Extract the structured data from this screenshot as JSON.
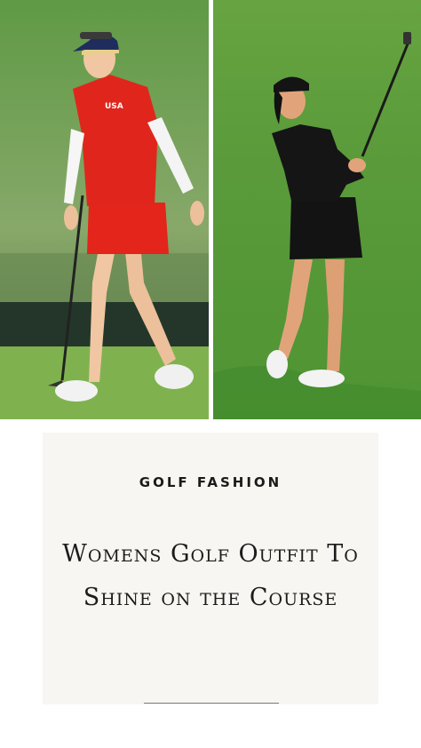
{
  "photos": {
    "left": {
      "shirt_text": "USA"
    },
    "right": {}
  },
  "card": {
    "eyebrow": "GOLF FASHION",
    "headline": "Womens Golf Outfit To Shine on the Course"
  },
  "colors": {
    "card_background": "#f8f6f2",
    "text": "#1c1c1c",
    "outfit_red": "#e0261c",
    "outfit_black": "#111111",
    "grass": "#4e9a3a"
  }
}
